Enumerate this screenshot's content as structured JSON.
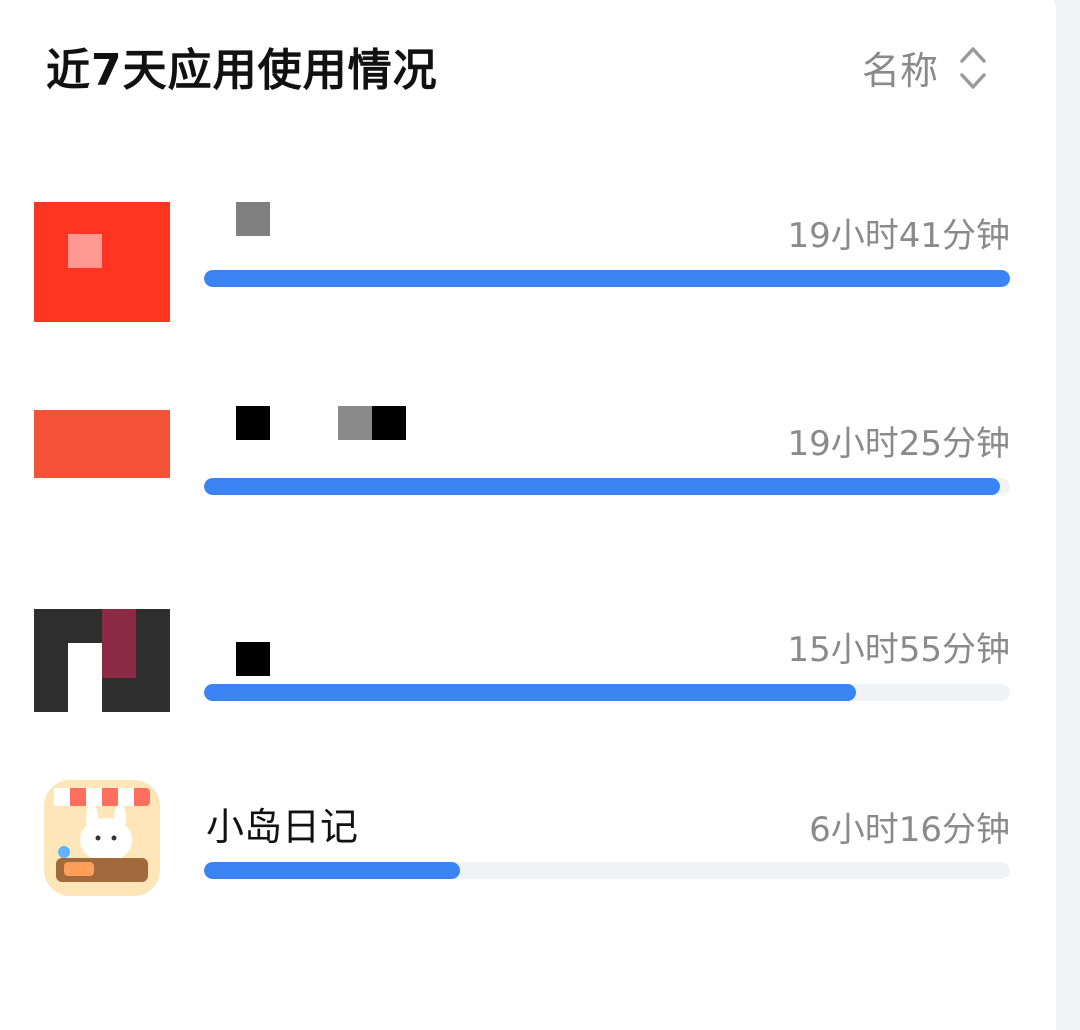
{
  "header": {
    "title": "近7天应用使用情况",
    "sort_label": "名称"
  },
  "colors": {
    "accent": "#3b84f5",
    "track": "#f1f2f6",
    "muted": "#8a8a8a"
  },
  "apps": [
    {
      "name": "",
      "duration": "19小时41分钟",
      "usage_fraction": 1.0,
      "icon": "app-icon-red"
    },
    {
      "name": "",
      "duration": "19小时25分钟",
      "usage_fraction": 0.987,
      "icon": "app-icon-orange-red"
    },
    {
      "name": "",
      "duration": "15小时55分钟",
      "usage_fraction": 0.809,
      "icon": "app-icon-dark"
    },
    {
      "name": "小岛日记",
      "duration": "6小时16分钟",
      "usage_fraction": 0.318,
      "icon": "app-icon-xiaodao-riji"
    }
  ]
}
